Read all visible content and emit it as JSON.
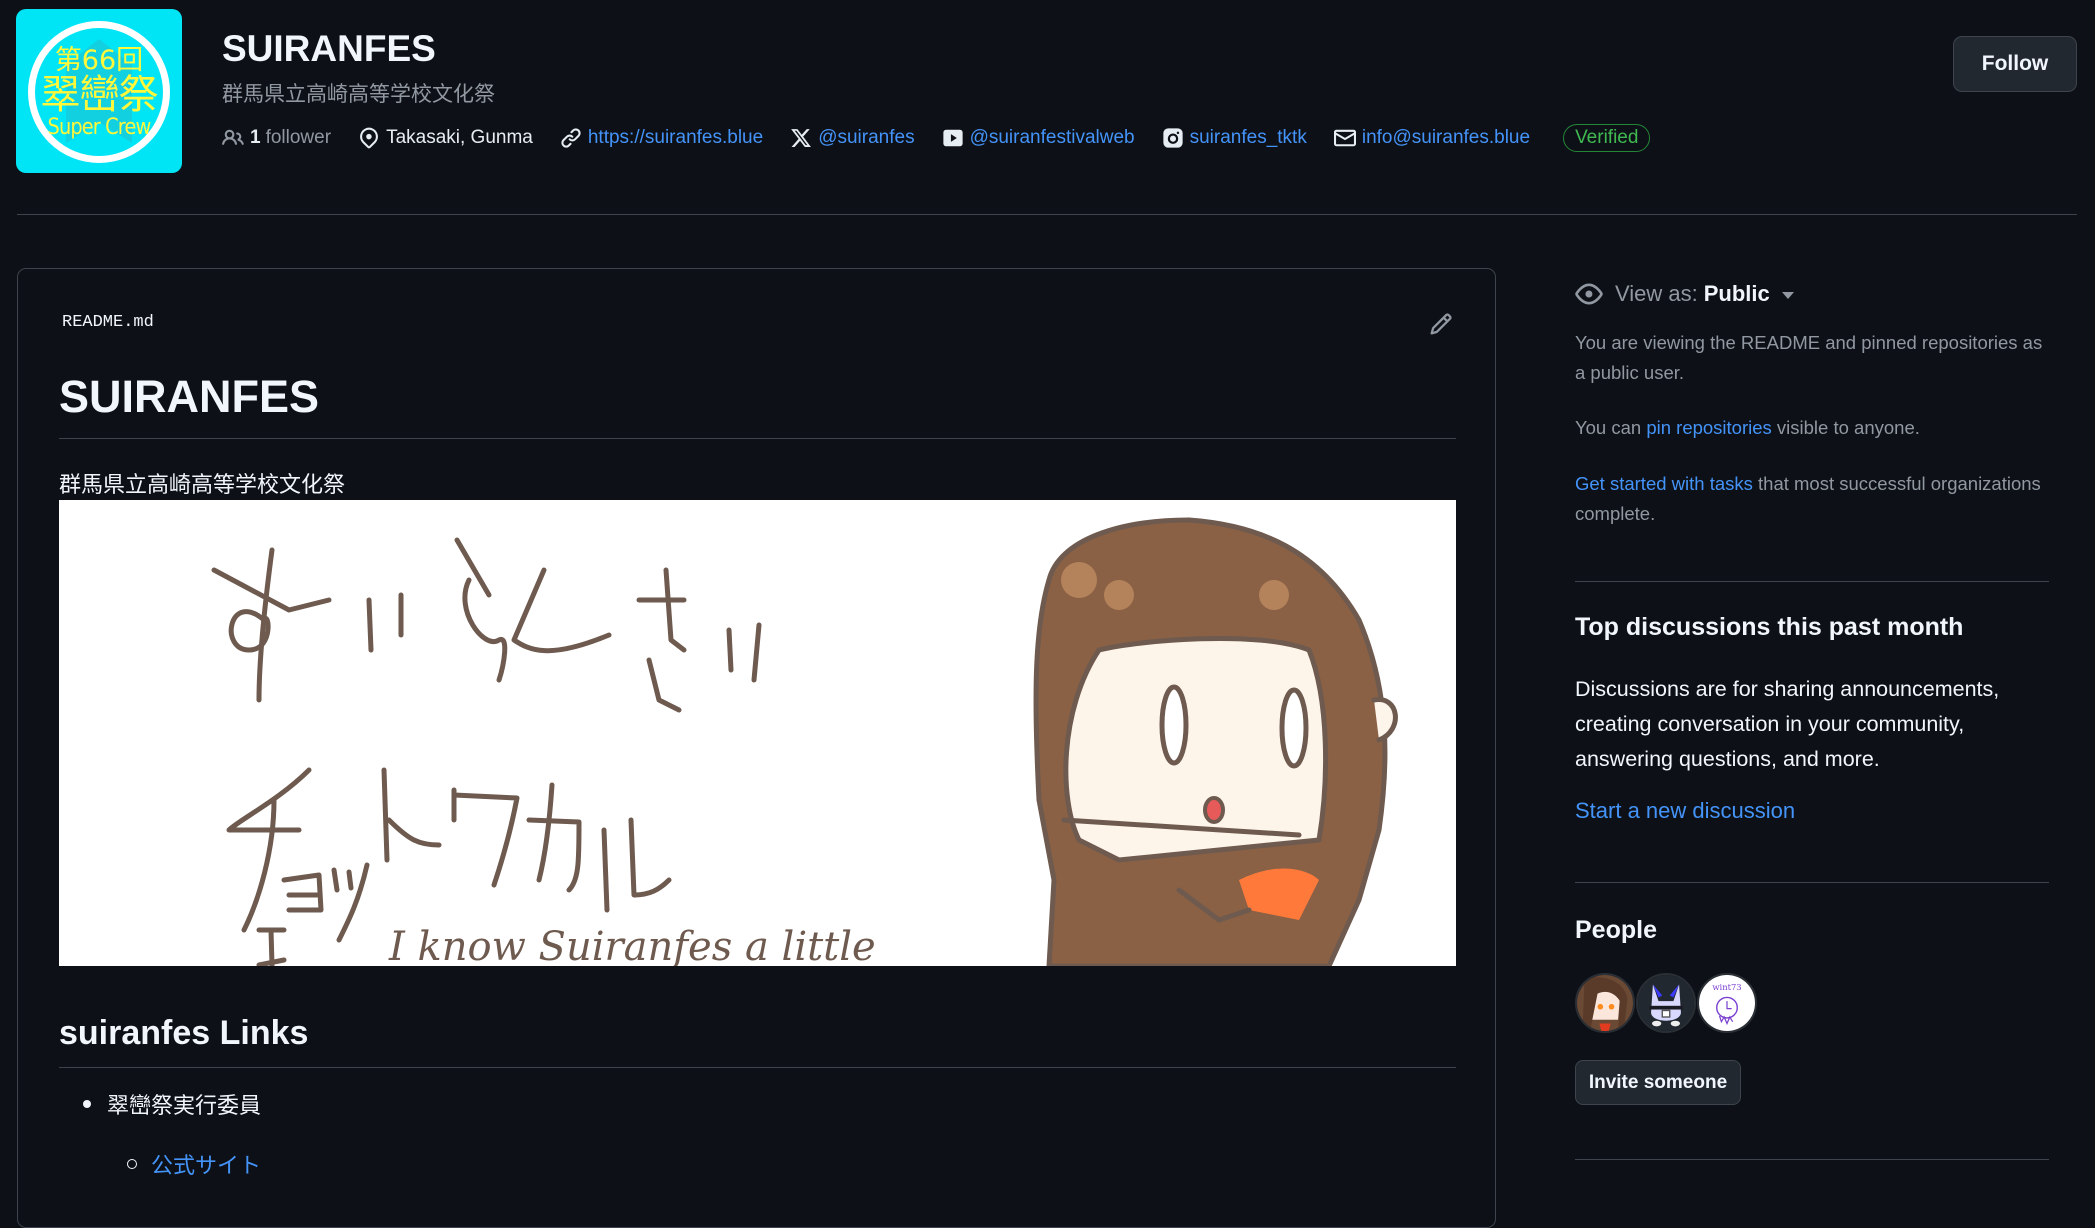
{
  "org": {
    "logo": {
      "line1": "第66回",
      "line2": "翠巒祭",
      "line3": "Super Crew",
      "bg_color": "#00e5f5",
      "text_color": "#fff83a"
    },
    "name": "SUIRANFES",
    "description": "群馬県立高崎高等学校文化祭",
    "meta": {
      "followers_count": "1",
      "followers_label": "follower",
      "location": "Takasaki, Gunma",
      "website": "https://suiranfes.blue",
      "x_handle": "@suiranfes",
      "youtube_handle": "@suiranfestivalweb",
      "instagram_handle": "suiranfes_tktk",
      "email": "info@suiranfes.blue",
      "verified_label": "Verified"
    },
    "follow_label": "Follow"
  },
  "readme": {
    "filename": "README.md",
    "title": "SUIRANFES",
    "subtitle": "群馬県立高崎高等学校文化祭",
    "banner": {
      "line1": "すいらんさい",
      "line2": "チョットワカル",
      "caption": "I know Suiranfes a little"
    },
    "links_heading": "suiranfes Links",
    "list": [
      {
        "label": "翠巒祭実行委員",
        "children": [
          {
            "label": "公式サイト"
          }
        ]
      }
    ]
  },
  "sidebar": {
    "view_as": {
      "label": "View as:",
      "value": "Public"
    },
    "viewing_text": "You are viewing the README and pinned repositories as a public user.",
    "pin_text": {
      "before": "You can ",
      "link": "pin repositories",
      "after": " visible to anyone."
    },
    "tasks_text": {
      "link": "Get started with tasks",
      "after": " that most successful organizations complete."
    },
    "discussions": {
      "heading": "Top discussions this past month",
      "body": "Discussions are for sharing announcements, creating conversation in your community, answering questions, and more.",
      "link": "Start a new discussion"
    },
    "people": {
      "heading": "People",
      "avatars": [
        {
          "name": "member-avatar-1"
        },
        {
          "name": "member-avatar-2"
        },
        {
          "name": "member-avatar-3",
          "text": "wint73"
        }
      ],
      "invite_label": "Invite someone"
    }
  },
  "colors": {
    "background": "#0d1117",
    "border": "#3d444d",
    "text": "#f0f6fc",
    "muted": "#9198a1",
    "link": "#4493f8",
    "verified": "#3fb950"
  }
}
